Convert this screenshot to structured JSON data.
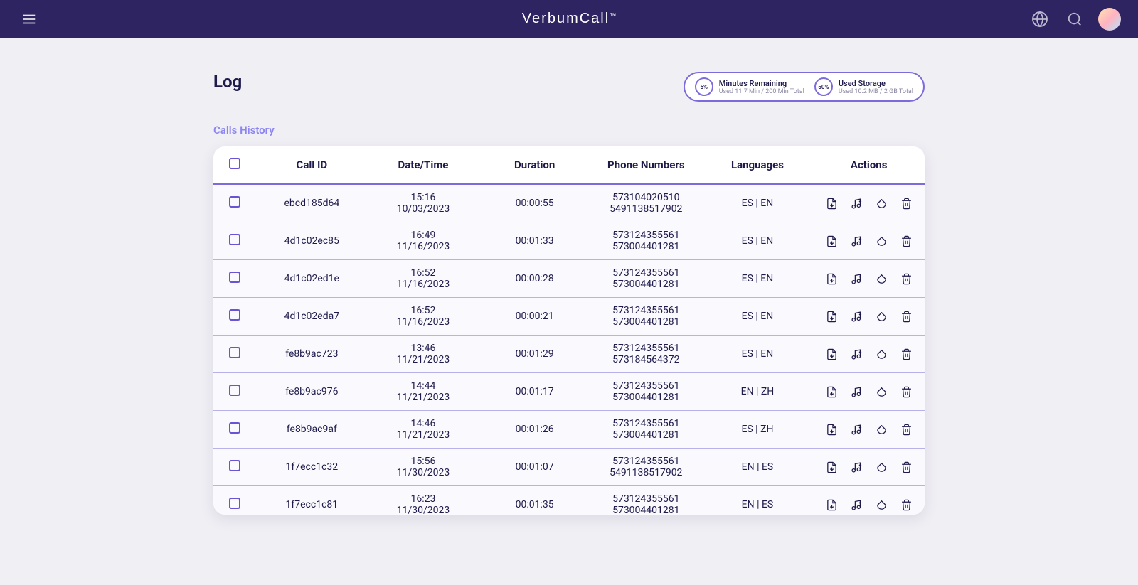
{
  "header": {
    "logo_text": "VerbumCall",
    "logo_tm": "™"
  },
  "page": {
    "title": "Log",
    "tab": "Calls History"
  },
  "usage": {
    "minutes": {
      "pct": "6%",
      "title": "Minutes Remaining",
      "sub": "Used 11.7 Min / 200 Min Total"
    },
    "storage": {
      "pct": "50%",
      "title": "Used Storage",
      "sub": "Used 10.2 MB / 2 GB Total"
    }
  },
  "columns": {
    "call_id": "Call ID",
    "date_time": "Date/Time",
    "duration": "Duration",
    "phone_numbers": "Phone Numbers",
    "languages": "Languages",
    "actions": "Actions"
  },
  "rows": [
    {
      "call_id": "ebcd185d64",
      "time": "15:16",
      "date": "10/03/2023",
      "duration": "00:00:55",
      "phone1": "573104020510",
      "phone2": "5491138517902",
      "languages": "ES | EN"
    },
    {
      "call_id": "4d1c02ec85",
      "time": "16:49",
      "date": "11/16/2023",
      "duration": "00:01:33",
      "phone1": "573124355561",
      "phone2": "573004401281",
      "languages": "ES | EN"
    },
    {
      "call_id": "4d1c02ed1e",
      "time": "16:52",
      "date": "11/16/2023",
      "duration": "00:00:28",
      "phone1": "573124355561",
      "phone2": "573004401281",
      "languages": "ES | EN"
    },
    {
      "call_id": "4d1c02eda7",
      "time": "16:52",
      "date": "11/16/2023",
      "duration": "00:00:21",
      "phone1": "573124355561",
      "phone2": "573004401281",
      "languages": "ES | EN"
    },
    {
      "call_id": "fe8b9ac723",
      "time": "13:46",
      "date": "11/21/2023",
      "duration": "00:01:29",
      "phone1": "573124355561",
      "phone2": "573184564372",
      "languages": "ES | EN"
    },
    {
      "call_id": "fe8b9ac976",
      "time": "14:44",
      "date": "11/21/2023",
      "duration": "00:01:17",
      "phone1": "573124355561",
      "phone2": "573004401281",
      "languages": "EN | ZH"
    },
    {
      "call_id": "fe8b9ac9af",
      "time": "14:46",
      "date": "11/21/2023",
      "duration": "00:01:26",
      "phone1": "573124355561",
      "phone2": "573004401281",
      "languages": "ES | ZH"
    },
    {
      "call_id": "1f7ecc1c32",
      "time": "15:56",
      "date": "11/30/2023",
      "duration": "00:01:07",
      "phone1": "573124355561",
      "phone2": "5491138517902",
      "languages": "EN | ES"
    },
    {
      "call_id": "1f7ecc1c81",
      "time": "16:23",
      "date": "11/30/2023",
      "duration": "00:01:35",
      "phone1": "573124355561",
      "phone2": "573004401281",
      "languages": "EN | ES"
    }
  ]
}
